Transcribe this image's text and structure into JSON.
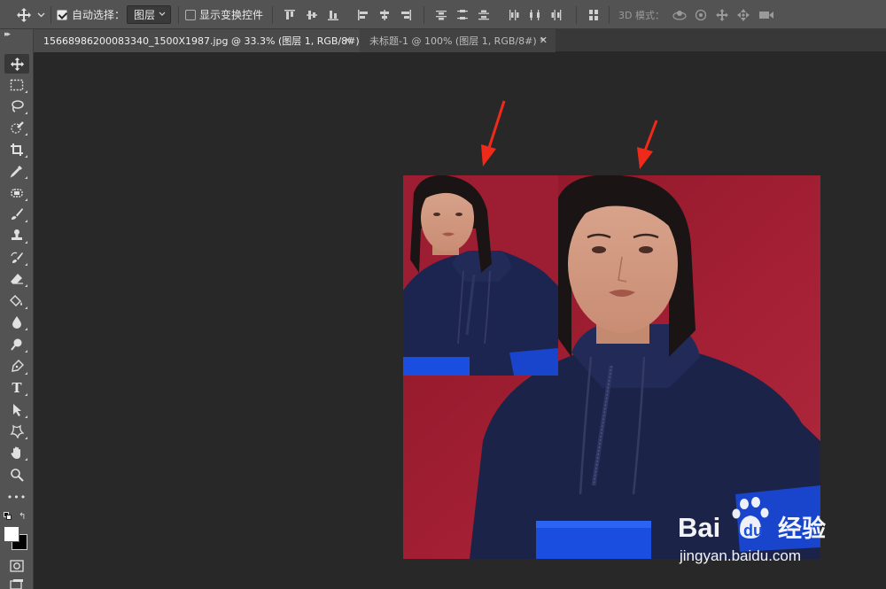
{
  "options_bar": {
    "auto_select_label": "自动选择：",
    "auto_select_checked": true,
    "auto_select_target": "图层",
    "show_transform_label": "显示变换控件",
    "show_transform_checked": false,
    "mode_3d_label": "3D 模式："
  },
  "tabs": [
    {
      "label": "15668986200083340_1500X1987.jpg @ 33.3% (图层 1, RGB/8#) *",
      "active": true
    },
    {
      "label": "未标题-1 @ 100% (图层 1, RGB/8#) *",
      "active": false
    }
  ],
  "toolbar": {
    "tools": [
      "move-tool",
      "marquee-tool",
      "lasso-tool",
      "quick-select-tool",
      "crop-tool",
      "eyedropper-tool",
      "healing-brush-tool",
      "brush-tool",
      "clone-stamp-tool",
      "history-brush-tool",
      "eraser-tool",
      "paint-bucket-tool",
      "blur-tool",
      "dodge-tool",
      "pen-tool",
      "type-tool",
      "path-select-tool",
      "custom-shape-tool",
      "hand-tool",
      "zoom-tool",
      "edit-toolbar"
    ],
    "type_tool_glyph": "T",
    "more_glyph": "•••",
    "foreground_color": "#ffffff",
    "background_color": "#000000"
  },
  "canvas": {
    "backdrop_color": "#a01e2e",
    "hoodie_color": "#1c2450",
    "pocket_color": "#1a4ee0",
    "annotation_arrow_color": "#f02a1a"
  },
  "watermark": {
    "brand_prefix": "Bai",
    "brand_suffix": "经验",
    "url": "jingyan.baidu.com"
  }
}
